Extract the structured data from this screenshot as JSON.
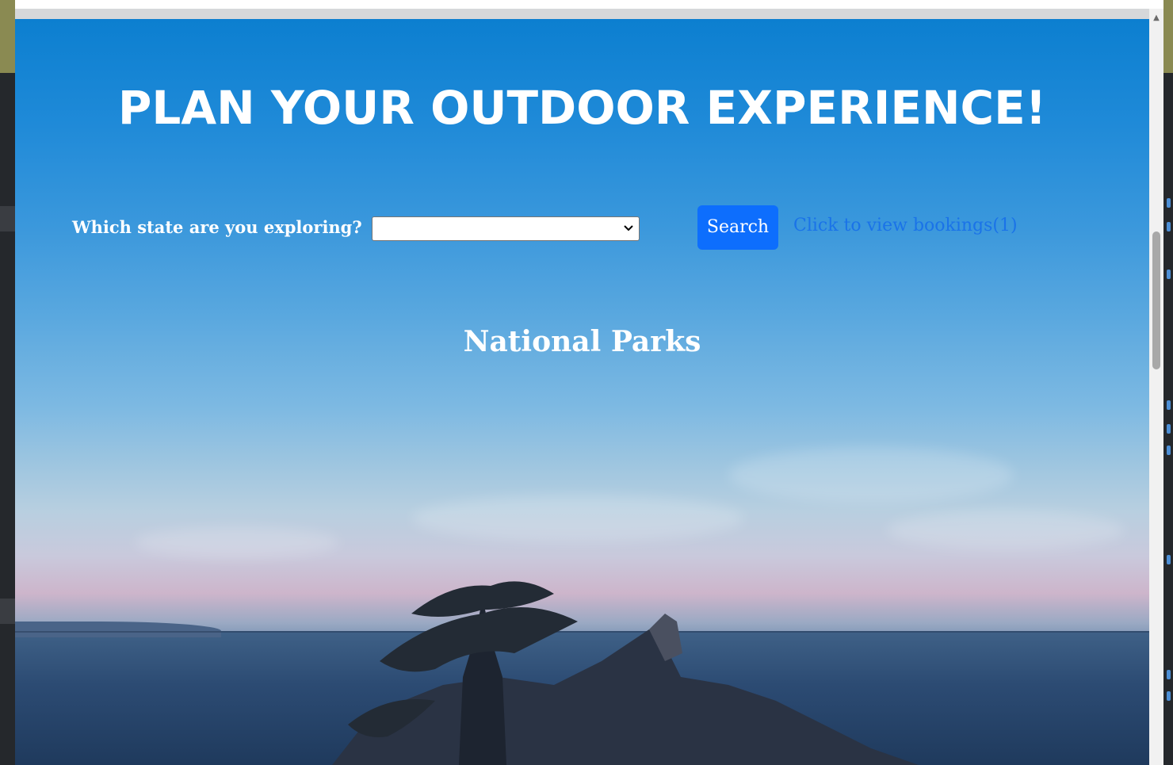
{
  "hero": {
    "title": "PLAN YOUR OUTDOOR EXPERIENCE!"
  },
  "search": {
    "state_label": "Which state are you exploring?",
    "state_select_value": "",
    "search_button": "Search",
    "bookings_link": "Click to view bookings(1)"
  },
  "section": {
    "title": "National Parks"
  },
  "colors": {
    "primary_button": "#0d6efd",
    "link": "#1a73e8",
    "sky_top": "#0c7fd0",
    "sea": "#2c4b73"
  },
  "icons": {
    "select_arrow": "chevron-down-icon",
    "scroll_up": "scroll-up-arrow-icon"
  }
}
